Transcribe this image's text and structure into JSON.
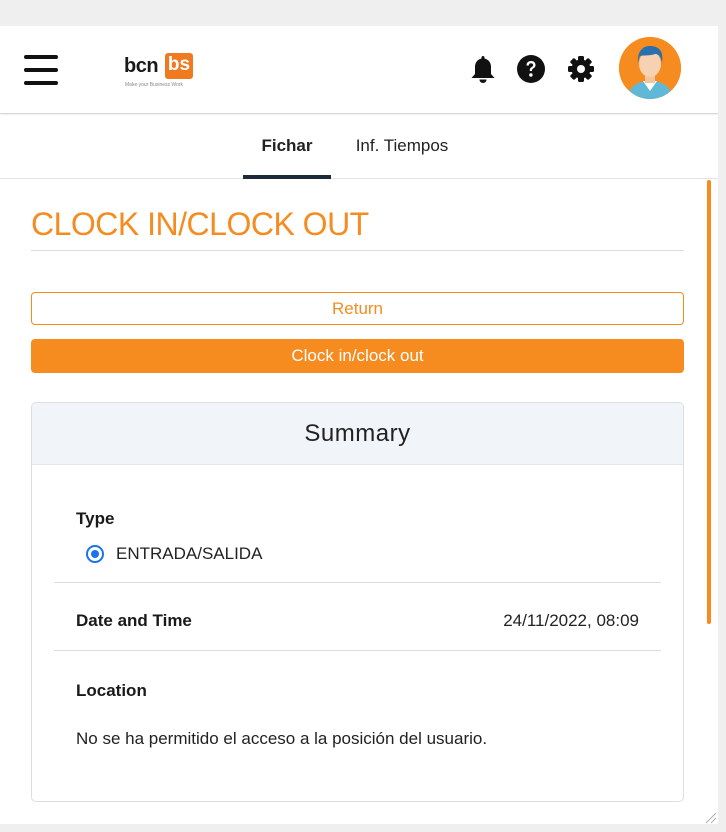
{
  "header": {
    "logo_text": "bcn",
    "logo_box": "bs",
    "logo_tagline": "Make your Business Work",
    "icons": [
      "menu-icon",
      "bell-icon",
      "help-icon",
      "gear-icon",
      "avatar"
    ]
  },
  "tabs": [
    {
      "label": "Fichar",
      "active": true
    },
    {
      "label": "Inf. Tiempos",
      "active": false
    }
  ],
  "page": {
    "title": "CLOCK IN/CLOCK OUT",
    "return_label": "Return",
    "clock_label": "Clock in/clock out"
  },
  "summary": {
    "title": "Summary",
    "type_label": "Type",
    "type_option": "ENTRADA/SALIDA",
    "type_selected": true,
    "datetime_label": "Date and Time",
    "datetime_value": "24/11/2022, 08:09",
    "location_label": "Location",
    "location_value": "No se ha permitido el acceso a la posición del usuario."
  },
  "colors": {
    "accent": "#f68b1f",
    "radio": "#1a73e8",
    "tab_indicator": "#1c2a3a"
  }
}
